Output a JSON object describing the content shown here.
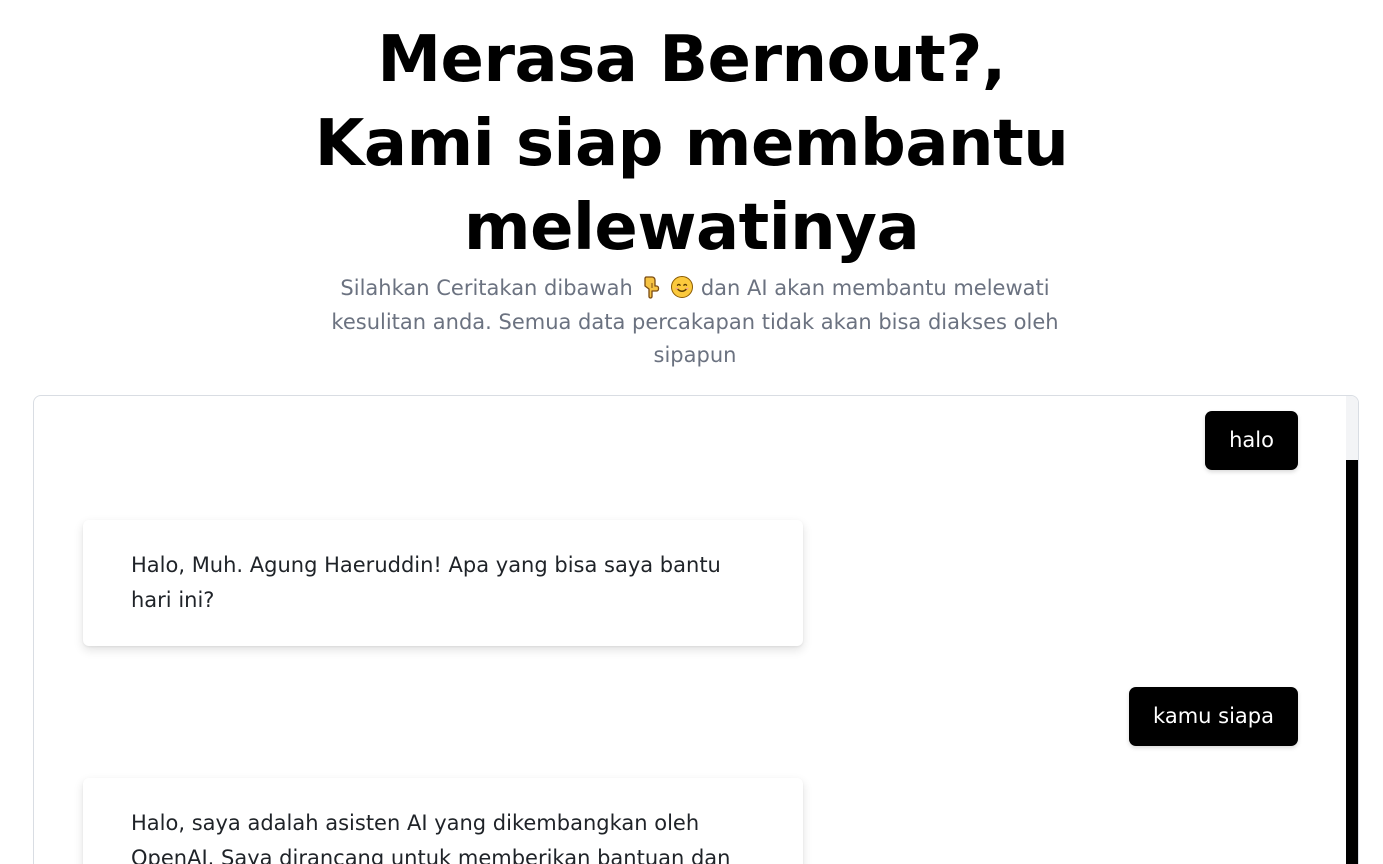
{
  "hero": {
    "title_line1": "Merasa Bernout?,",
    "title_line2": "Kami siap membantu",
    "title_line3": "melewatinya",
    "subtitle_before": "Silahkan Ceritakan dibawah",
    "subtitle_emoji_1": "pointing-down-hand-icon",
    "subtitle_emoji_2": "smiling-face-icon",
    "subtitle_after": "dan AI akan membantu melewati kesulitan anda. Semua data percakapan tidak akan bisa diakses oleh sipapun"
  },
  "chat": {
    "messages": [
      {
        "role": "user",
        "text": "halo"
      },
      {
        "role": "assistant",
        "text": "Halo, Muh. Agung Haeruddin! Apa yang bisa saya bantu hari ini?"
      },
      {
        "role": "user",
        "text": "kamu siapa"
      },
      {
        "role": "assistant",
        "text": "Halo, saya adalah asisten AI yang dikembangkan oleh OpenAI. Saya dirancang untuk memberikan bantuan dan"
      }
    ]
  },
  "colors": {
    "user_bubble": "#000000",
    "subtitle_text": "#6b7280",
    "scrollbar_thumb": "#000000"
  }
}
